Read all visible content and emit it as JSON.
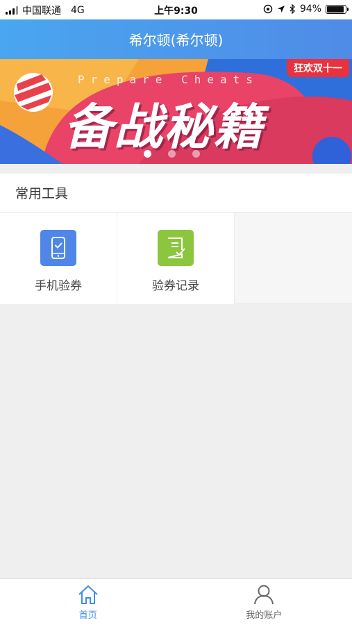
{
  "status_bar": {
    "carrier": "中国联通",
    "network": "4G",
    "time": "上午9:30",
    "battery": "94%",
    "battery_level": 0.94
  },
  "header": {
    "title": "希尔顿(希尔顿)"
  },
  "banner": {
    "eng_text": "Prepare Cheats",
    "title": "备战秘籍",
    "badge": "狂欢双十一",
    "slide_count": 3,
    "active_slide": 1
  },
  "tools_section": {
    "title": "常用工具",
    "items": [
      {
        "label": "手机验券",
        "icon": "phone-check-icon",
        "color": "#4f86e8"
      },
      {
        "label": "验券记录",
        "icon": "record-check-icon",
        "color": "#8cc63f"
      }
    ]
  },
  "tabbar": {
    "active_color": "#3d8ee6",
    "inactive_color": "#666666",
    "tabs": [
      {
        "label": "首页",
        "icon": "home-icon",
        "active": true
      },
      {
        "label": "我的账户",
        "icon": "user-icon",
        "active": false
      }
    ]
  }
}
